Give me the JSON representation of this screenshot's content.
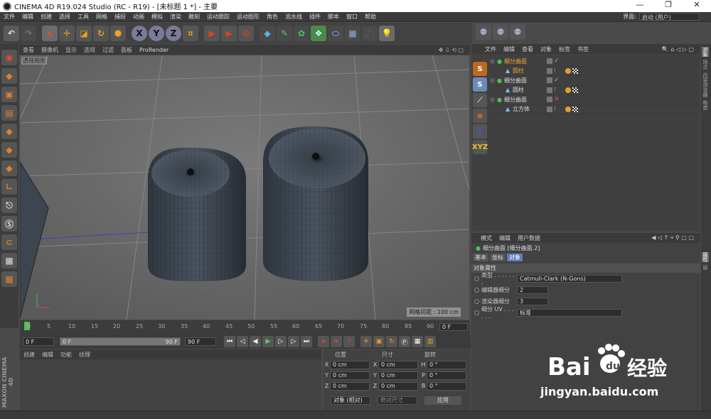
{
  "window": {
    "title": "CINEMA 4D R19.024 Studio (RC - R19) - [未标题 1 *] - 主要",
    "controls": [
      "—",
      "❐",
      "✕"
    ]
  },
  "menu": {
    "items": [
      "文件",
      "编辑",
      "创建",
      "选择",
      "工具",
      "网格",
      "捕捉",
      "动画",
      "模拟",
      "渲染",
      "雕刻",
      "运动跟踪",
      "运动图形",
      "角色",
      "流水线",
      "插件",
      "脚本",
      "窗口",
      "帮助"
    ],
    "layout_label": "界面:",
    "layout_value": "启动 (用户)"
  },
  "viewport": {
    "menu": [
      "查看",
      "摄像机",
      "显示",
      "选项",
      "过滤",
      "面板",
      "ProRender"
    ],
    "label": "透视视图",
    "grid_info": "网格间距 : 100 cm"
  },
  "timeline": {
    "ticks": [
      "0",
      "5",
      "10",
      "15",
      "20",
      "25",
      "30",
      "35",
      "40",
      "45",
      "50",
      "55",
      "60",
      "65",
      "70",
      "75",
      "80",
      "85",
      "90"
    ],
    "current_frame": "0 F"
  },
  "playbar": {
    "start": "0 F",
    "min": "0 F",
    "max": "90 F",
    "end": "90 F"
  },
  "material_panel": {
    "menu": [
      "创建",
      "编辑",
      "功能",
      "纹理"
    ]
  },
  "coord_panel": {
    "headers": [
      "位置",
      "尺寸",
      "旋转"
    ],
    "rows": [
      {
        "ax1": "X",
        "pos": "0 cm",
        "ax2": "X",
        "size": "0 cm",
        "ax3": "H",
        "rot": "0 °"
      },
      {
        "ax1": "Y",
        "pos": "0 cm",
        "ax2": "Y",
        "size": "0 cm",
        "ax3": "P",
        "rot": "0 °"
      },
      {
        "ax1": "Z",
        "pos": "0 cm",
        "ax2": "Z",
        "size": "0 cm",
        "ax3": "B",
        "rot": "0 °"
      }
    ],
    "mode": "对象 (相对)",
    "size_mode": "绝对尺寸",
    "apply": "应用"
  },
  "object_manager": {
    "menu": [
      "文件",
      "编辑",
      "查看",
      "对象",
      "标签",
      "书签"
    ],
    "rows": [
      {
        "name": "细分曲面",
        "type": "parent",
        "status": "check"
      },
      {
        "name": "圆柱",
        "type": "child",
        "status": "none"
      },
      {
        "name": "细分曲面",
        "type": "parent",
        "status": "check"
      },
      {
        "name": "圆柱",
        "type": "child",
        "status": "none"
      },
      {
        "name": "细分曲面",
        "type": "parent",
        "status": "x"
      },
      {
        "name": "立方体",
        "type": "child",
        "status": "none"
      }
    ]
  },
  "attribute_manager": {
    "menu": [
      "模式",
      "编辑",
      "用户数据"
    ],
    "title": "细分曲面 [细分曲面.2]",
    "tabs": [
      "基本",
      "坐标",
      "对象"
    ],
    "section": "对象属性",
    "props": [
      {
        "label": "类型 . . . . . . .",
        "value": "Catmull-Clark (N-Gons)"
      },
      {
        "label": "编辑器细分",
        "value": "2"
      },
      {
        "label": "渲染器细分",
        "value": "3"
      },
      {
        "label": "细分 UV . . . . . .",
        "value": "标准"
      }
    ]
  },
  "right_tabs": [
    "对象",
    "场次",
    "内容浏览器",
    "构造"
  ],
  "attr_right_tabs": [
    "属性",
    "层"
  ],
  "branding": "MAXON CINEMA 4D",
  "watermark": {
    "brand": "Bai du 经验",
    "url": "jingyan.baidu.com"
  },
  "colors": {
    "accent_blue": "#5b7fb8",
    "orange": "#f0a63a",
    "check_green": "#6fd46f",
    "x_red": "#e05050"
  }
}
